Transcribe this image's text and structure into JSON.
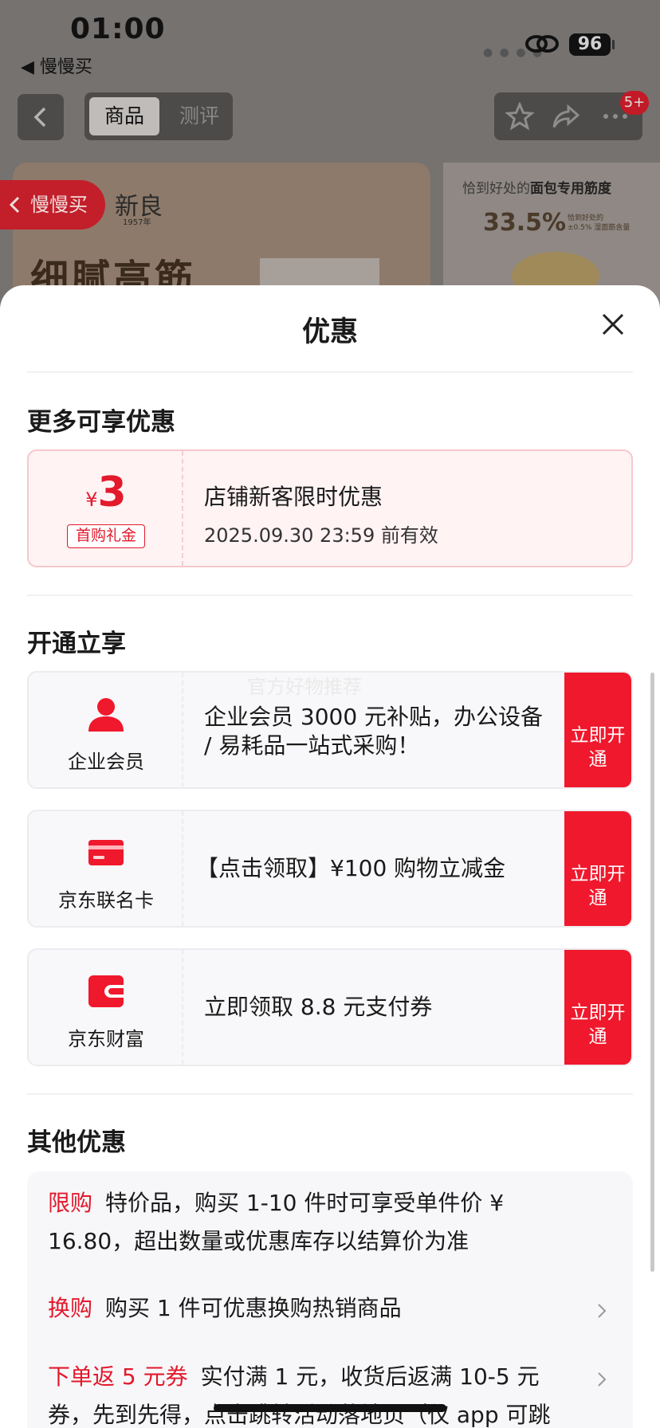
{
  "status_bar": {
    "time": "01:00",
    "back_app": "◀ 慢慢买",
    "battery": "96"
  },
  "nav": {
    "tabs": [
      "商品",
      "测评"
    ],
    "badge": "5+"
  },
  "hero": {
    "brand": "新良",
    "year": "1957年",
    "title": "细腻高筋",
    "right_text_prefix": "恰到好处的",
    "right_text_bold": "面包专用筋度",
    "percent": "33.5%",
    "percent_note_1": "恰到好处的",
    "percent_note_2": "±0.5% 湿面筋含量"
  },
  "float_back": {
    "label": "慢慢买"
  },
  "sheet": {
    "title": "优惠",
    "more_section": {
      "title": "更多可享优惠",
      "coupon": {
        "currency": "¥",
        "amount": "3",
        "tag": "首购礼金",
        "name": "店铺新客限时优惠",
        "valid": "2025.09.30 23:59 前有效"
      }
    },
    "open_section": {
      "title": "开通立享",
      "watermark": "官方好物推荐",
      "cards": [
        {
          "name": "企业会员",
          "icon": "person-icon",
          "text": " 企业会员 3000 元补贴，办公设备 / 易耗品一站式采购！",
          "button": "立即开通"
        },
        {
          "name": "京东联名卡",
          "icon": "credit-card-icon",
          "text": "【点击领取】¥100 购物立减金",
          "button": "立即开通"
        },
        {
          "name": "京东财富",
          "icon": "wallet-icon",
          "text": "立即领取 8.8 元支付券",
          "button": "立即开通"
        }
      ]
    },
    "other_section": {
      "title": "其他优惠",
      "rows": [
        {
          "tag": "限购",
          "text": "特价品，购买 1-10 件时可享受单件价 ¥ 16.80，超出数量或优惠库存以结算价为准"
        },
        {
          "tag": "换购",
          "text": "购买 1 件可优惠换购热销商品"
        },
        {
          "tag": "下单返 5 元券",
          "text": "实付满 1 元，收货后返满 10-5 元券，先到先得，点击跳转活动落地页（仅 app 可跳转）"
        }
      ]
    }
  },
  "colors": {
    "accent_red": "#f0182c",
    "coupon_bg": "#fff3f4",
    "card_bg": "#f8f8fa"
  }
}
